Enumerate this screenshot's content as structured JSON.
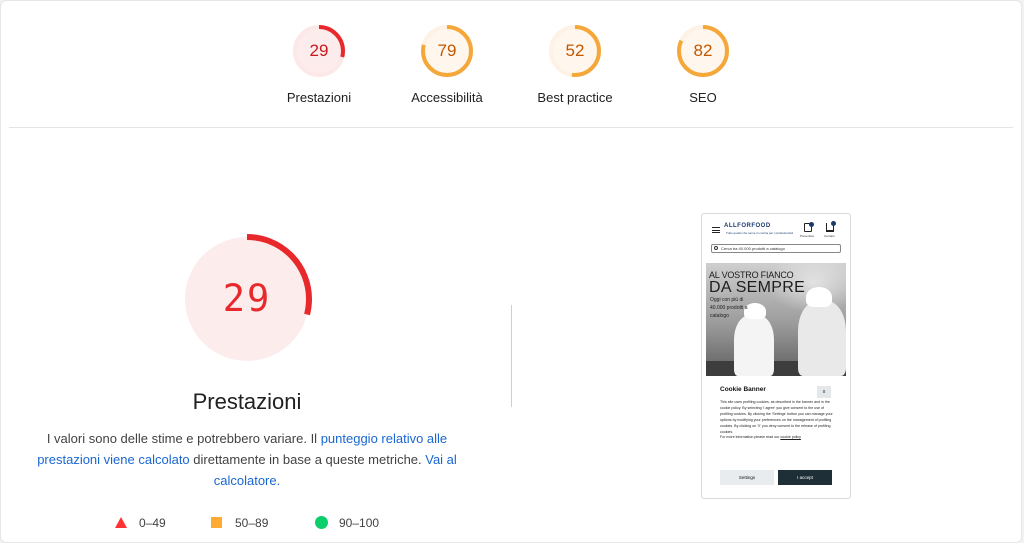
{
  "colors": {
    "fail": "#ff3333",
    "average": "#ffaa33",
    "pass": "#0cce6b",
    "link": "#1967d2"
  },
  "gauges": [
    {
      "label": "Prestazioni",
      "score": "29",
      "value": 29,
      "color": "#e8282b",
      "track": "#fde8e8",
      "fill": "#fdecec",
      "text": "#c8191d"
    },
    {
      "label": "Accessibilità",
      "score": "79",
      "value": 79,
      "color": "#f5a83a",
      "track": "#fdf2e4",
      "fill": "#fff7ee",
      "text": "#c25700"
    },
    {
      "label": "Best practice",
      "score": "52",
      "value": 52,
      "color": "#f5a83a",
      "track": "#fdf2e4",
      "fill": "#fff7ee",
      "text": "#c25700"
    },
    {
      "label": "SEO",
      "score": "82",
      "value": 82,
      "color": "#f5a83a",
      "track": "#fdf2e4",
      "fill": "#fff7ee",
      "text": "#c25700"
    }
  ],
  "main": {
    "score": "29",
    "value": 29,
    "title": "Prestazioni",
    "desc_1": "I valori sono delle stime e potrebbero variare. Il ",
    "link_1": "punteggio relativo alle prestazioni viene calcolato",
    "desc_2": " direttamente in base a queste metriche. ",
    "link_2": "Vai al calcolatore."
  },
  "legend": [
    {
      "shape": "triangle",
      "label": "0–49"
    },
    {
      "shape": "square",
      "label": "50–89"
    },
    {
      "shape": "circle",
      "label": "90–100"
    }
  ],
  "screenshot": {
    "logo": "ALLFORFOOD",
    "logo_sub": "Tutto quello che serve in cucina per i professionisti",
    "icon_1": "Preventivo",
    "icon_2": "Carrello",
    "search_placeholder": "Cerca tra 40.000 prodotti a catalogo",
    "hero_line1": "AL VOSTRO FIANCO",
    "hero_line2": "DA SEMPRE",
    "hero_line3": "Oggi con più di 40.000 prodotti a catalogo",
    "cookie_title": "Cookie Banner",
    "cookie_close": "x",
    "cookie_text": "This site uses profiling cookies, as described in the banner and in the cookie policy. By selecting 'I agree' you give consent to the use of profiling cookies. By clicking the 'Settings' button you can manage your options by modifying your preferences on the management of profiling cookies. By clicking on 'X' you deny consent to the release of profiling cookies.",
    "cookie_more": "For more information please read our ",
    "cookie_link": "cookie policy",
    "settings_label": "Settings",
    "accept_label": "I accept"
  }
}
